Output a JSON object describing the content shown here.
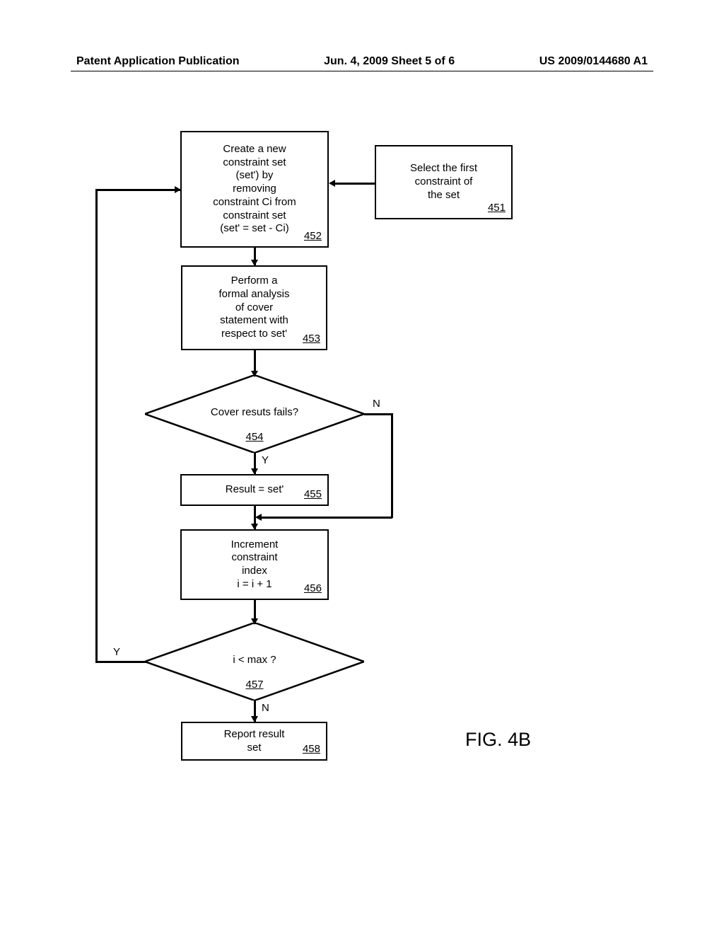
{
  "header": {
    "left": "Patent Application Publication",
    "center": "Jun. 4, 2009  Sheet 5 of 6",
    "right": "US 2009/0144680 A1"
  },
  "figure_label": "FIG. 4B",
  "nodes": {
    "n451": {
      "text": "Select the first\nconstraint of\nthe set",
      "ref": "451"
    },
    "n452": {
      "text": "Create a new\nconstraint set\n(set') by\nremoving\nconstraint Ci from\nconstraint set\n(set' = set - Ci)",
      "ref": "452"
    },
    "n453": {
      "text": "Perform a\nformal analysis\nof cover\nstatement with\nrespect to set'",
      "ref": "453"
    },
    "n454": {
      "text": "Cover resuts fails?",
      "ref": "454"
    },
    "n455": {
      "text": "Result = set'",
      "ref": "455"
    },
    "n456": {
      "text": "Increment\nconstraint\nindex\ni = i + 1",
      "ref": "456"
    },
    "n457": {
      "text": "i < max ?",
      "ref": "457"
    },
    "n458": {
      "text": "Report result\nset",
      "ref": "458"
    }
  },
  "edge_labels": {
    "d454_yes": "Y",
    "d454_no": "N",
    "d457_yes": "Y",
    "d457_no": "N"
  }
}
